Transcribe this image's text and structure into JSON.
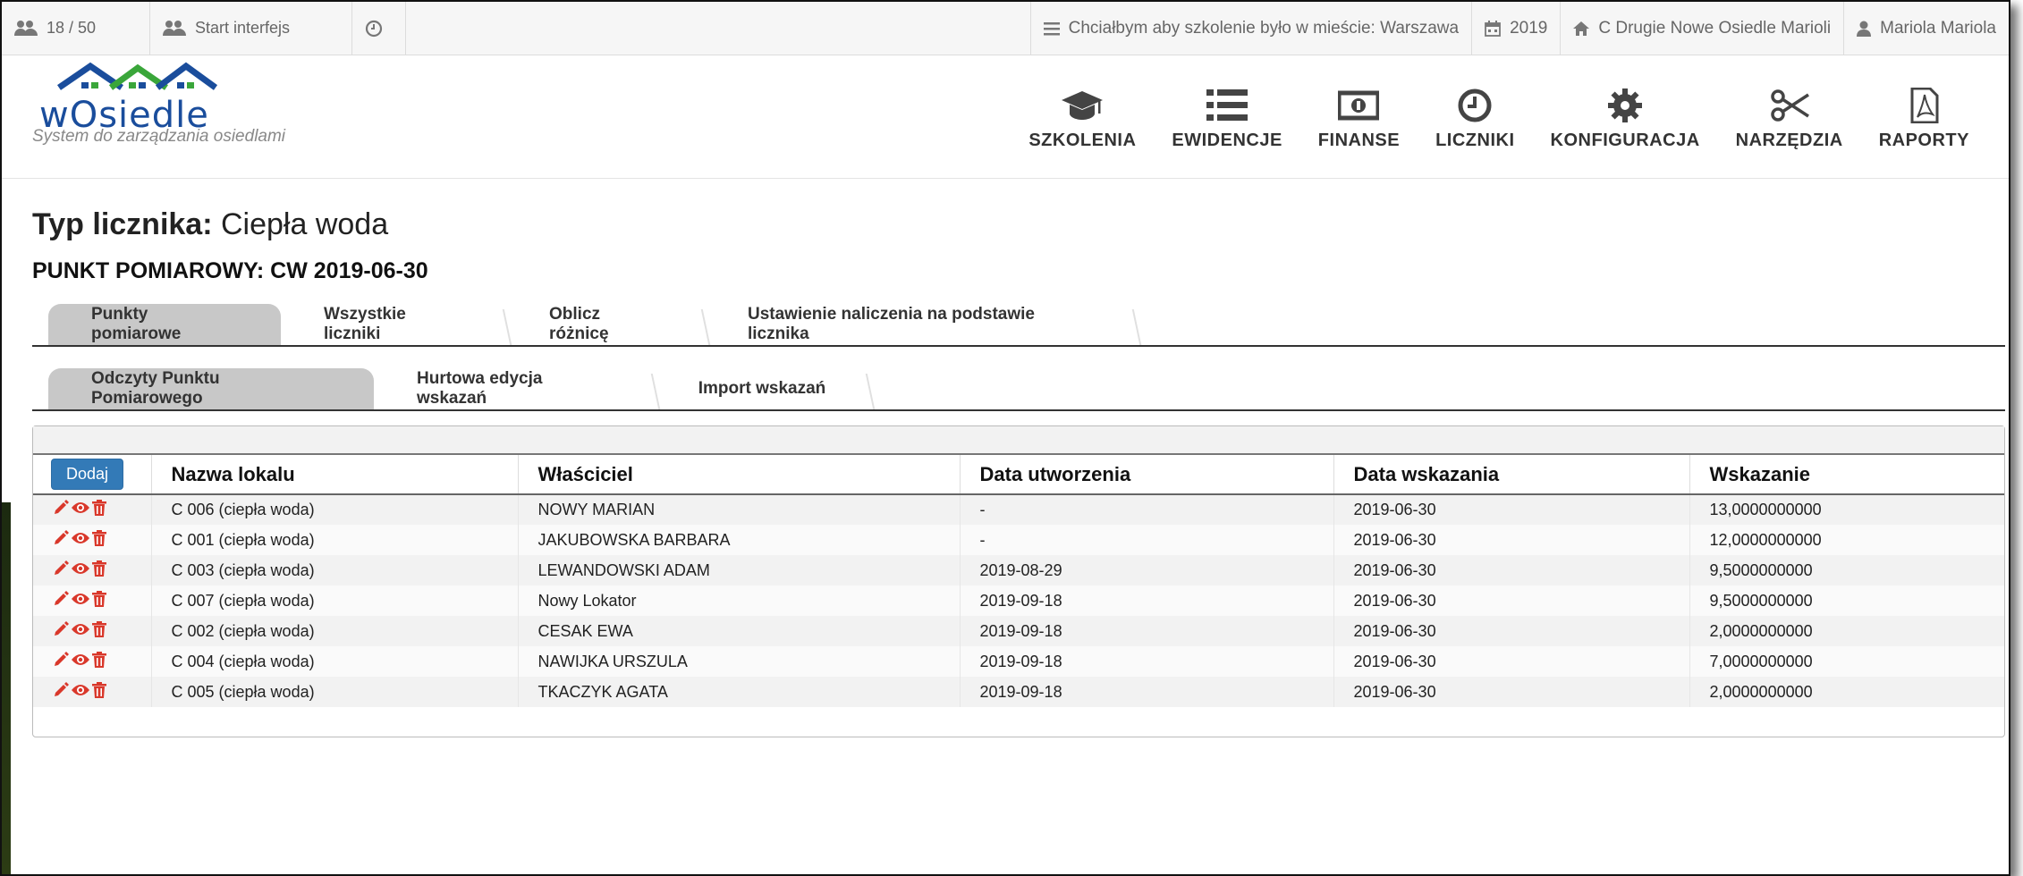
{
  "topbar": {
    "users_count": "18 / 50",
    "start_interface": "Start interfejs",
    "training_city": "Chciałbym aby szkolenie było w mieście: Warszawa",
    "year": "2019",
    "estate": "C Drugie Nowe Osiedle Marioli",
    "user": "Mariola Mariola"
  },
  "logo": {
    "text": "wOsiedle",
    "subtitle": "System do zarządzania osiedlami"
  },
  "nav": [
    {
      "label": "SZKOLENIA",
      "icon": "graduation-cap-icon"
    },
    {
      "label": "EWIDENCJE",
      "icon": "list-icon"
    },
    {
      "label": "FINANSE",
      "icon": "money-icon"
    },
    {
      "label": "LICZNIKI",
      "icon": "clock-icon"
    },
    {
      "label": "KONFIGURACJA",
      "icon": "gear-icon"
    },
    {
      "label": "NARZĘDZIA",
      "icon": "scissors-icon"
    },
    {
      "label": "RAPORTY",
      "icon": "pdf-icon"
    }
  ],
  "page": {
    "title_label": "Typ licznika:",
    "title_value": "Ciepła woda",
    "subtitle": "PUNKT POMIAROWY: CW 2019-06-30"
  },
  "tabs1": [
    "Punkty pomiarowe",
    "Wszystkie liczniki",
    "Oblicz różnicę",
    "Ustawienie naliczenia na podstawie licznika"
  ],
  "tabs2": [
    "Odczyty Punktu Pomiarowego",
    "Hurtowa edycja wskazań",
    "Import wskazań"
  ],
  "table": {
    "add_label": "Dodaj",
    "headers": [
      "Nazwa lokalu",
      "Właściciel",
      "Data utworzenia",
      "Data wskazania",
      "Wskazanie"
    ],
    "rows": [
      [
        "C 006 (ciepła woda)",
        "NOWY MARIAN",
        "-",
        "2019-06-30",
        "13,0000000000"
      ],
      [
        "C 001 (ciepła woda)",
        "JAKUBOWSKA BARBARA",
        "-",
        "2019-06-30",
        "12,0000000000"
      ],
      [
        "C 003 (ciepła woda)",
        "LEWANDOWSKI ADAM",
        "2019-08-29",
        "2019-06-30",
        "9,5000000000"
      ],
      [
        "C 007 (ciepła woda)",
        "Nowy Lokator",
        "2019-09-18",
        "2019-06-30",
        "9,5000000000"
      ],
      [
        "C 002 (ciepła woda)",
        "CESAK EWA",
        "2019-09-18",
        "2019-06-30",
        "2,0000000000"
      ],
      [
        "C 004 (ciepła woda)",
        "NAWIJKA URSZULA",
        "2019-09-18",
        "2019-06-30",
        "7,0000000000"
      ],
      [
        "C 005 (ciepła woda)",
        "TKACZYK AGATA",
        "2019-09-18",
        "2019-06-30",
        "2,0000000000"
      ]
    ]
  },
  "colors": {
    "primary_button": "#337ab7",
    "action_icons": "#d9382b",
    "logo_blue": "#1a4d9c",
    "logo_green": "#3aa63a"
  }
}
